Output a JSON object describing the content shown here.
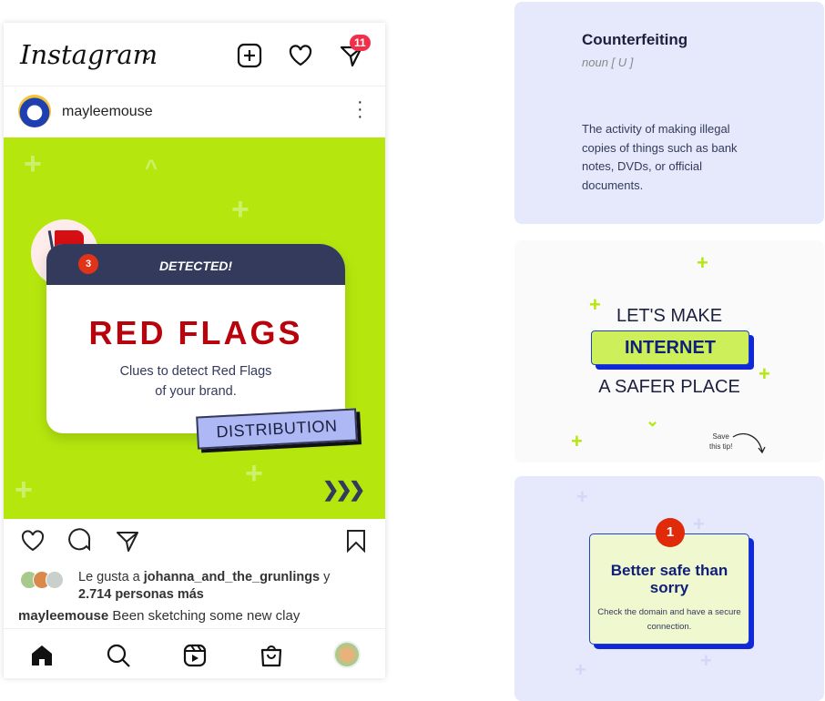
{
  "app": {
    "logo": "Instagram",
    "message_badge": "11"
  },
  "post": {
    "username": "mayleemouse",
    "detected": "DETECTED!",
    "title": "RED FLAGS",
    "subtitle_line1": "Clues to detect Red Flags",
    "subtitle_line2": "of your brand.",
    "flag_count": "3",
    "tag": "DISTRIBUTION"
  },
  "likes": {
    "prefix": "Le gusta a",
    "user": "johanna_and_the_grunlings",
    "and": "y",
    "others": "2.714 personas más"
  },
  "caption": {
    "user": "mayleemouse",
    "text": "Been sketching some new clay"
  },
  "card1": {
    "term": "Counterfeiting",
    "pos": "noun [ U ]",
    "definition": "The activity of making illegal copies of things such as bank notes, DVDs, or official documents."
  },
  "card2": {
    "line1": "LET'S MAKE",
    "highlight": "INTERNET",
    "line3": "A SAFER PLACE",
    "save1": "Save",
    "save2": "this tip!"
  },
  "card3": {
    "number": "1",
    "title": "Better safe than sorry",
    "body": "Check the domain and have a secure connection."
  }
}
